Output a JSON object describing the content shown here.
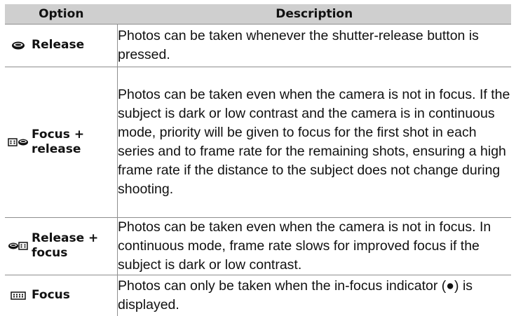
{
  "table": {
    "headers": {
      "option": "Option",
      "description": "Description"
    },
    "rows": [
      {
        "icon": "shutter-release-icon",
        "option": "Release",
        "description": "Photos can be taken whenever the shutter-release button is pressed."
      },
      {
        "icon": "focus-plus-release-icon",
        "option": "Focus +\nrelease",
        "description": "Photos can be taken even when the camera is not in focus.  If the subject is dark or low contrast and the camera is in continuous mode, priority will be given to focus for the first shot in each series and to frame rate for the remaining shots, ensuring a high frame rate if the distance to the subject does not change during shooting."
      },
      {
        "icon": "release-plus-focus-icon",
        "option": "Release +\nfocus",
        "description": "Photos can be taken even when the camera is not in focus.  In continuous mode, frame rate slows for improved focus if the subject is dark or low contrast."
      },
      {
        "icon": "focus-icon",
        "option": "Focus",
        "description": "Photos can only be taken when the in-focus indicator (●) is displayed."
      }
    ]
  }
}
